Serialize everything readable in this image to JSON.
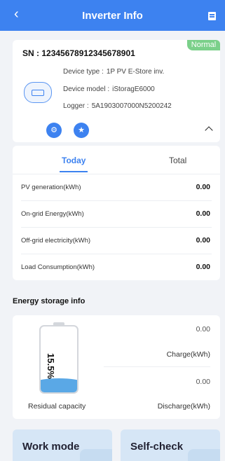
{
  "header": {
    "title": "Inverter Info",
    "back_icon": "chevron-left-icon",
    "doc_icon": "document-icon"
  },
  "device": {
    "status": "Normal",
    "status_color": "#7bd08a",
    "sn_label": "SN :",
    "sn_value": "12345678912345678901",
    "device_type_label": "Device type :",
    "device_type": "1P PV E-Store inv.",
    "device_model_label": "Device model :",
    "device_model": "iStoragE6000",
    "logger_label": "Logger :",
    "logger": "5A1903007000N5200242",
    "settings_icon": "gear-icon",
    "favorite_icon": "star-icon",
    "collapse_icon": "chevron-up-icon"
  },
  "energy": {
    "tabs": [
      {
        "label": "Today",
        "active": true
      },
      {
        "label": "Total",
        "active": false
      }
    ],
    "rows": [
      {
        "label": "PV generation(kWh)",
        "value": "0.00"
      },
      {
        "label": "On-grid Energy(kWh)",
        "value": "0.00"
      },
      {
        "label": "Off-grid electricity(kWh)",
        "value": "0.00"
      },
      {
        "label": "Load Consumption(kWh)",
        "value": "0.00"
      }
    ]
  },
  "storage": {
    "section_title": "Energy storage info",
    "battery_percent": "15.5%",
    "battery_level": 0.155,
    "residual_label": "Residual capacity",
    "charge_value": "0.00",
    "charge_label": "Charge(kWh)",
    "discharge_value": "0.00",
    "discharge_label": "Discharge(kWh)"
  },
  "actions": {
    "work_mode": "Work mode",
    "self_check": "Self-check"
  },
  "colors": {
    "accent": "#3d82f0",
    "battery_fill": "#5aa8e6"
  }
}
